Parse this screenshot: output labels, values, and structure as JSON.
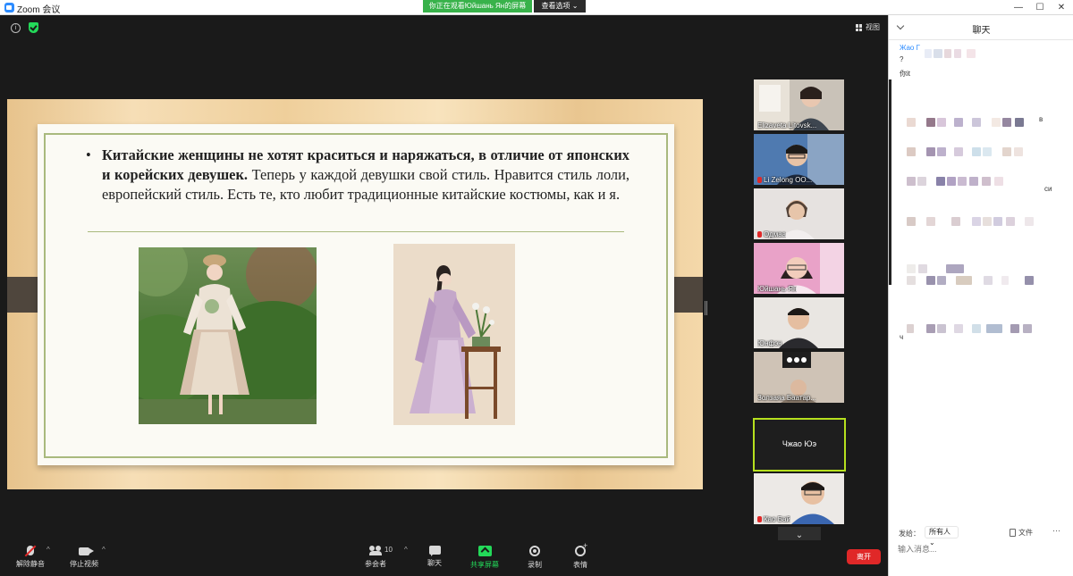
{
  "window": {
    "title": "Zoom 会议",
    "share_banner": "你正在观看Юйшань Ян的屏幕",
    "view_options": "查看选项 ⌄",
    "minimize": "—",
    "maximize": "☐",
    "close": "✕"
  },
  "header": {
    "view_label": "视图"
  },
  "slide": {
    "text_bold": "Китайские женщины не хотят краситься и наряжаться, в отличие от японских и корейских девушек.",
    "text_regular": " Теперь у каждой девушки свой стиль. Нравится стиль лоли, европейский стиль.  Есть те, кто любит традиционные китайские костюмы, как и я."
  },
  "participants": [
    {
      "name": "Elizaveta Litovsk...",
      "muted": false
    },
    {
      "name": "Li Zelong OO...",
      "muted": true
    },
    {
      "name": "Одмаа",
      "muted": true
    },
    {
      "name": "Юйшань Ян",
      "muted": false
    },
    {
      "name": "Юнфэн",
      "muted": false
    },
    {
      "name": "Золзаяа Баатар...",
      "muted": false
    },
    {
      "name": "Чжао Юэ",
      "muted": false
    },
    {
      "name": "Као Бай",
      "muted": true
    }
  ],
  "thumbs_scroll": "⌄",
  "toolbar": {
    "mute": "解除静音",
    "video": "停止视频",
    "participants": "参会者",
    "participant_count": "10",
    "chat": "聊天",
    "share": "共享屏幕",
    "record": "录制",
    "reactions": "表情",
    "end": "离开",
    "caret": "^"
  },
  "chat": {
    "title": "聊天",
    "first_sender": "Жао Г",
    "first_message": "?",
    "second_message": "你it",
    "fragment_1": "в",
    "fragment_2": "си",
    "fragment_3": "ч",
    "footer_label": "发给：",
    "recipient": "所有人 ⌄",
    "file_label": "文件",
    "more": "···",
    "input_placeholder": "输入消息..."
  },
  "colors": {
    "accent_green": "#23d959",
    "banner_green": "#38b24a",
    "end_red": "#e02828",
    "active_speaker": "#b6e01e",
    "chat_sender_blue": "#2d8cff"
  }
}
